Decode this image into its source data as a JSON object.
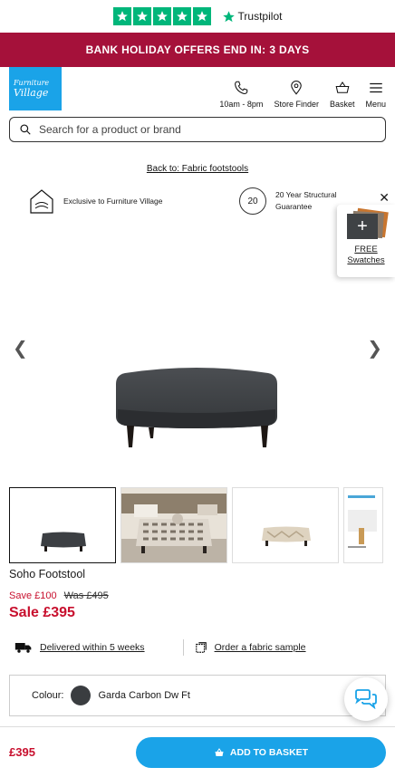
{
  "trustpilot": {
    "brand": "Trustpilot",
    "stars": 5,
    "color": "#00b67a"
  },
  "promo": {
    "text": "BANK HOLIDAY OFFERS END IN:",
    "countdown": "3 DAYS",
    "color": "#a5113a"
  },
  "header": {
    "logo_line1": "Furniture",
    "logo_line2": "Village",
    "nav": [
      {
        "label": "10am - 8pm",
        "icon": "phone-icon"
      },
      {
        "label": "Store Finder",
        "icon": "location-pin-icon"
      },
      {
        "label": "Basket",
        "icon": "basket-icon"
      },
      {
        "label": "Menu",
        "icon": "hamburger-menu-icon"
      }
    ]
  },
  "search": {
    "placeholder": "Search for a product or brand"
  },
  "breadcrumb": {
    "back_label": "Back to: Fabric footstools"
  },
  "usps": [
    {
      "text": "Exclusive to Furniture Village",
      "icon": "house-logo-icon"
    },
    {
      "text": "20 Year Structural Guarantee",
      "badge": "20",
      "icon": "guarantee-badge-icon"
    }
  ],
  "swatches": {
    "label": "FREE Swatches",
    "icon": "plus-icon"
  },
  "product": {
    "title": "Soho Footstool",
    "save": "Save £100",
    "was": "Was £495",
    "sale": "Sale £395",
    "thumbnails": [
      "Footstool front view",
      "Footstool in living room",
      "Patterned fabric footstool",
      "Leg variations"
    ]
  },
  "delivery": {
    "label": "Delivered within 5 weeks",
    "icon": "delivery-truck-icon"
  },
  "fabric_sample": {
    "label": "Order a fabric sample",
    "icon": "sample-icon"
  },
  "colour": {
    "label": "Colour:",
    "value": "Garda Carbon Dw Ft",
    "swatch_color": "#3a3d40"
  },
  "footer": {
    "price": "£395",
    "button": "ADD TO BASKET",
    "accent": "#1aa3e8"
  }
}
